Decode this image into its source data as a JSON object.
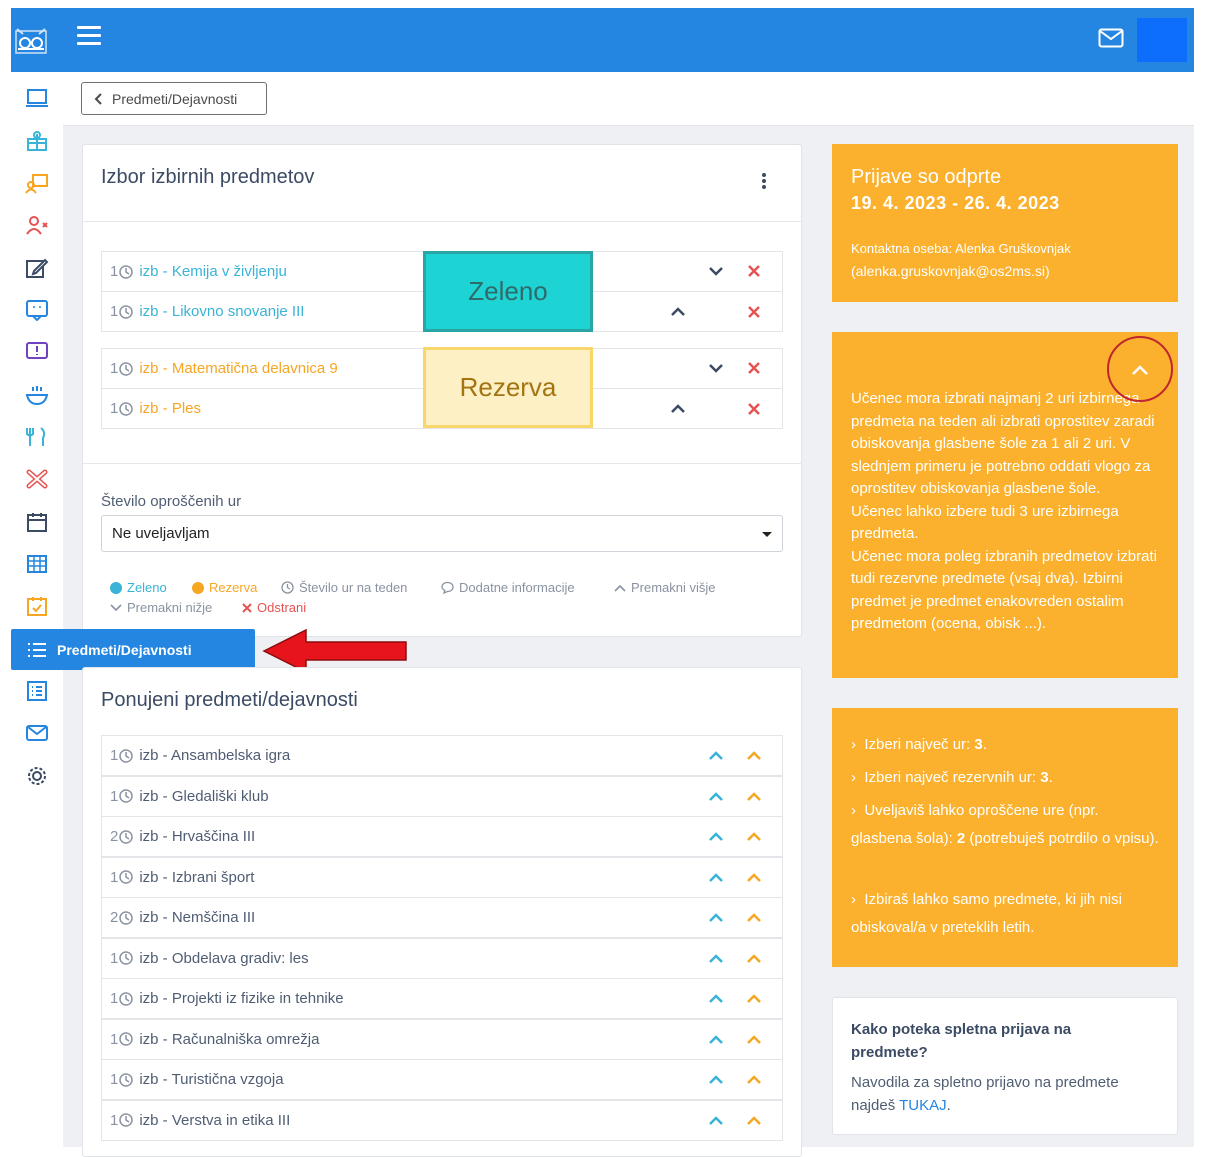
{
  "topbar": {
    "logo_icon": "owl-icon",
    "menu_icon": "hamburger-icon",
    "mail_icon": "envelope-icon"
  },
  "back_button": {
    "label": "Predmeti/Dejavnosti"
  },
  "selection_card": {
    "title": "Izbor izbirnih predmetov",
    "green_rows": [
      {
        "num": "1",
        "name": "izb - Kemija v življenju"
      },
      {
        "num": "1",
        "name": "izb - Likovno snovanje III"
      }
    ],
    "reserve_rows": [
      {
        "num": "1",
        "name": "izb - Matematična delavnica 9"
      },
      {
        "num": "1",
        "name": "izb - Ples"
      }
    ],
    "overlay_green": "Zeleno",
    "overlay_reserve": "Rezerva",
    "exempt_label": "Število oproščenih ur",
    "exempt_value": "Ne uveljavljam",
    "legend": {
      "green": "Zeleno",
      "reserve": "Rezerva",
      "hours": "Število ur na teden",
      "info": "Dodatne informacije",
      "up": "Premakni višje",
      "down": "Premakni nižje",
      "remove": "Odstrani"
    }
  },
  "offered_card": {
    "title": "Ponujeni predmeti/dejavnosti",
    "rows": [
      {
        "num": "1",
        "name": "izb - Ansambelska igra"
      },
      {
        "num": "1",
        "name": "izb - Gledališki klub"
      },
      {
        "num": "2",
        "name": "izb - Hrvaščina III"
      },
      {
        "num": "1",
        "name": "izb - Izbrani šport"
      },
      {
        "num": "2",
        "name": "izb - Nemščina III"
      },
      {
        "num": "1",
        "name": "izb - Obdelava gradiv: les"
      },
      {
        "num": "1",
        "name": "izb - Projekti iz fizike in tehnike"
      },
      {
        "num": "1",
        "name": "izb - Računalniška omrežja"
      },
      {
        "num": "1",
        "name": "izb - Turistična vzgoja"
      },
      {
        "num": "1",
        "name": "izb - Verstva in etika III"
      }
    ]
  },
  "sidebar": {
    "active_label": "Predmeti/Dejavnosti"
  },
  "info_dates": {
    "title": "Prijave so odprte",
    "dates": "19. 4. 2023 - 26. 4. 2023",
    "contact_label": "Kontaktna oseba: Alenka Gruškovnjak",
    "contact_email": "(alenka.gruskovnjak@os2ms.si)"
  },
  "info_rules": {
    "paragraphs": [
      "Učenec mora izbrati najmanj 2 uri izbirnega predmeta na teden ali izbrati oprostitev zaradi obiskovanja glasbene šole za 1 ali 2 uri. V slednjem primeru je potrebno oddati vlogo za oprostitev obiskovanja glasbene šole.",
      "Učenec lahko izbere tudi 3 ure izbirnega predmeta.",
      "Učenec mora poleg izbranih predmetov izbrati tudi rezervne predmete (vsaj dva). Izbirni predmet je predmet enakovreden ostalim predmetom (ocena, obisk ...)."
    ]
  },
  "info_limits": {
    "max_hours_label": "Izberi največ ur: ",
    "max_hours_value": "3",
    "max_reserve_label": "Izberi največ rezervnih ur: ",
    "max_reserve_value": "3",
    "exempt_text_a": "Uveljaviš lahko oproščene ure (npr. glasbena šola): ",
    "exempt_value": "2",
    "exempt_text_b": " (potrebuješ potrdilo o vpisu).",
    "previous_note": "Izbiraš lahko samo predmete, ki jih nisi obiskoval/a v preteklih letih."
  },
  "help_card": {
    "title": "Kako poteka spletna prijava na predmete?",
    "text": "Navodila za spletno prijavo na predmete najdeš ",
    "link": "TUKAJ",
    "end": "."
  },
  "colors": {
    "brand": "#2486e0",
    "green": "#39b3d7",
    "reserve": "#f6a623",
    "orange_card": "#fbb12d",
    "remove": "#e55353"
  }
}
